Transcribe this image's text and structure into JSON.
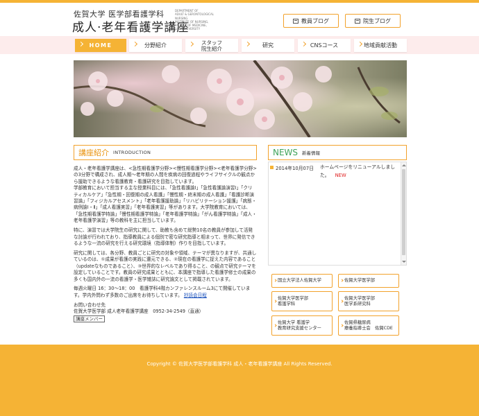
{
  "header": {
    "logo_top": "佐賀大学  医学部看護学科",
    "logo_main": "成人·老年看護学講座",
    "logo_sub": [
      "DEPARTMENT OF",
      "ADULT & GERONTOLOGICAL NURSING",
      "INSTITUTE OF NURSING,",
      "FACULTY OF MEDICINE,",
      "SAGA UNIVERSITY"
    ],
    "blog_faculty": "教員ブログ",
    "blog_grad": "院生ブログ"
  },
  "nav": {
    "home": "HOME",
    "field": "分野紹介",
    "staff_1": "スタッフ",
    "staff_2": "院生紹介",
    "research": "研究",
    "cns": "CNSコース",
    "community": "地域貢献活動"
  },
  "intro": {
    "title": "講座紹介",
    "title_en": "INTRODUCTION",
    "p1": "成人・老年看護学講座は、<急性期看護学分野><慢性期看護学分野><老年看護学分野>の3分野で構成され、成人期〜老年期の人間を疾病の回復過程やライフサイクルの観点から援助できるような看護教育・看護研究を目指しています。",
    "p1b": "学部教育において担当する主な授業科目には、「急性看護論Ⅰ」「急性看護論演習Ⅰ」「クリティカルケア」「急性期・回復期の成人看護」「慢性期・終末期の成人看護」「看護診断演習論」「フィジカルアセスメント」「老年看護援助論」「リハビリテーション援護」「病態・病例論Ⅰ・Ⅱ」「成人看護実習」「老年看護実習」等があります。大学院教育においては、「急性期看護学特論」「慢性期看護学特論」「老年看護学特論」「がん看護学特論」「成人・老年看護学演習」等の教科を主に担当しています。",
    "p2": "特に、演習では大学院生の研究に関して、助教も含めて総勢10名の教員が参加して活発な討論が行われており、指導教員による個別で密な研究指導と相まって、世界に発信できるような一流の研究を行える研究環境（指導体制）作りを目指しています。",
    "p3": "研究に関しては、各分野、教員ごとに研究の対象や領域、テーマが異なりますが、共通しているのは、①成果が看護の実践に還元できる、②現在の看護学に捉えた内容であること（updateなものであること）、③世界的なレベルであり得ること、の観点で研究テーマを設定していることです。教員の研究成果とともに、本講座で指導した看護学修士の成果の多くも国内外の一流の看護学・医学雑誌に研究論文として掲載されています。",
    "p4": "毎週火曜日 16：30〜18：00　看護学科4階カンファレンスルーム3にて開催しています。学内外問わず多数のご出席をお待ちしています。",
    "p4_link": "抄読会日程",
    "contact_label": "お問い合わせ先",
    "contact_line": "佐賀大学医学部 成人老年看護学講座　0952-34-2549（直通）",
    "member_button": "講座メンバー"
  },
  "news": {
    "title": "NEWS",
    "subtitle": "新着情報",
    "items": [
      {
        "date": "2014年10月07日",
        "text": "ホームページをリニューアルしました。",
        "badge": "NEW"
      }
    ]
  },
  "links": {
    "l1": "国立大学法人佐賀大学",
    "l2": "佐賀大学医学部",
    "l3a": "佐賀大学医学部",
    "l3b": "看護学科",
    "l4a": "佐賀大学医学部",
    "l4b": "医学系研究科",
    "l5a": "佐賀大学 看護学",
    "l5b": "教育研究支援センター",
    "l6a": "佐賀県糖尿病",
    "l6b": "療養指導士会　佐賀CDE"
  },
  "footer": {
    "copyright": "Copyright © 佐賀大学医学部看護学科 成人・老年看護学講座 All Rights Reserved."
  },
  "colors": {
    "accent": "#f5b335",
    "accent_border": "#f2a12a",
    "nav_band": "#fdecec",
    "news_green": "#3ea35a",
    "new_red": "#e02020"
  }
}
